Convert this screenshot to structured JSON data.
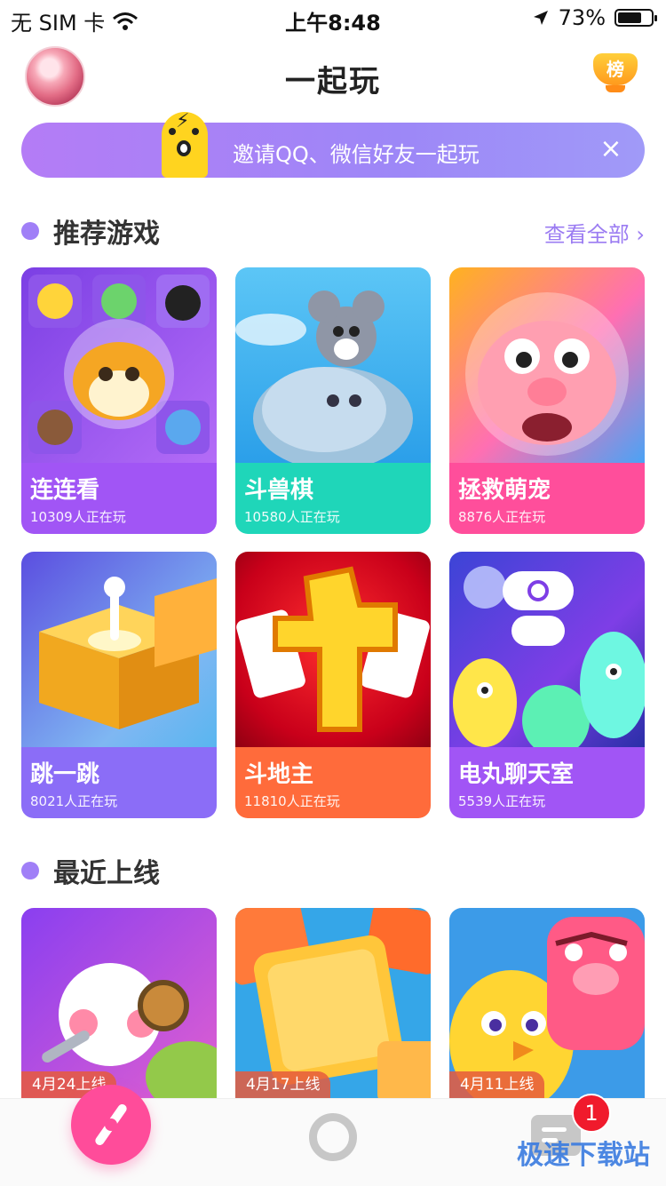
{
  "status_bar": {
    "carrier": "无 SIM 卡",
    "time": "上午8:48",
    "battery": "73%",
    "battery_level": 0.73
  },
  "header": {
    "title": "一起玩",
    "rank_label": "榜"
  },
  "invite_banner": {
    "text": "邀请QQ、微信好友一起玩",
    "close": "×"
  },
  "recommended": {
    "title": "推荐游戏",
    "view_all": "查看全部 ›",
    "games": [
      {
        "name": "连连看",
        "players": "10309人正在玩",
        "color": "#a155f5"
      },
      {
        "name": "斗兽棋",
        "players": "10580人正在玩",
        "color": "#1fd6b9"
      },
      {
        "name": "拯救萌宠",
        "players": "8876人正在玩",
        "color": "#ff4e9b"
      },
      {
        "name": "跳一跳",
        "players": "8021人正在玩",
        "color": "#8b6df7"
      },
      {
        "name": "斗地主",
        "players": "11810人正在玩",
        "color": "#ff6b3b"
      },
      {
        "name": "电丸聊天室",
        "players": "5539人正在玩",
        "color": "#a155f5"
      }
    ]
  },
  "recent": {
    "title": "最近上线",
    "games": [
      {
        "date": "4月24上线"
      },
      {
        "date": "4月17上线"
      },
      {
        "date": "4月11上线"
      }
    ]
  },
  "tabbar": {
    "message_badge": "1"
  },
  "watermark": "极速下载站"
}
